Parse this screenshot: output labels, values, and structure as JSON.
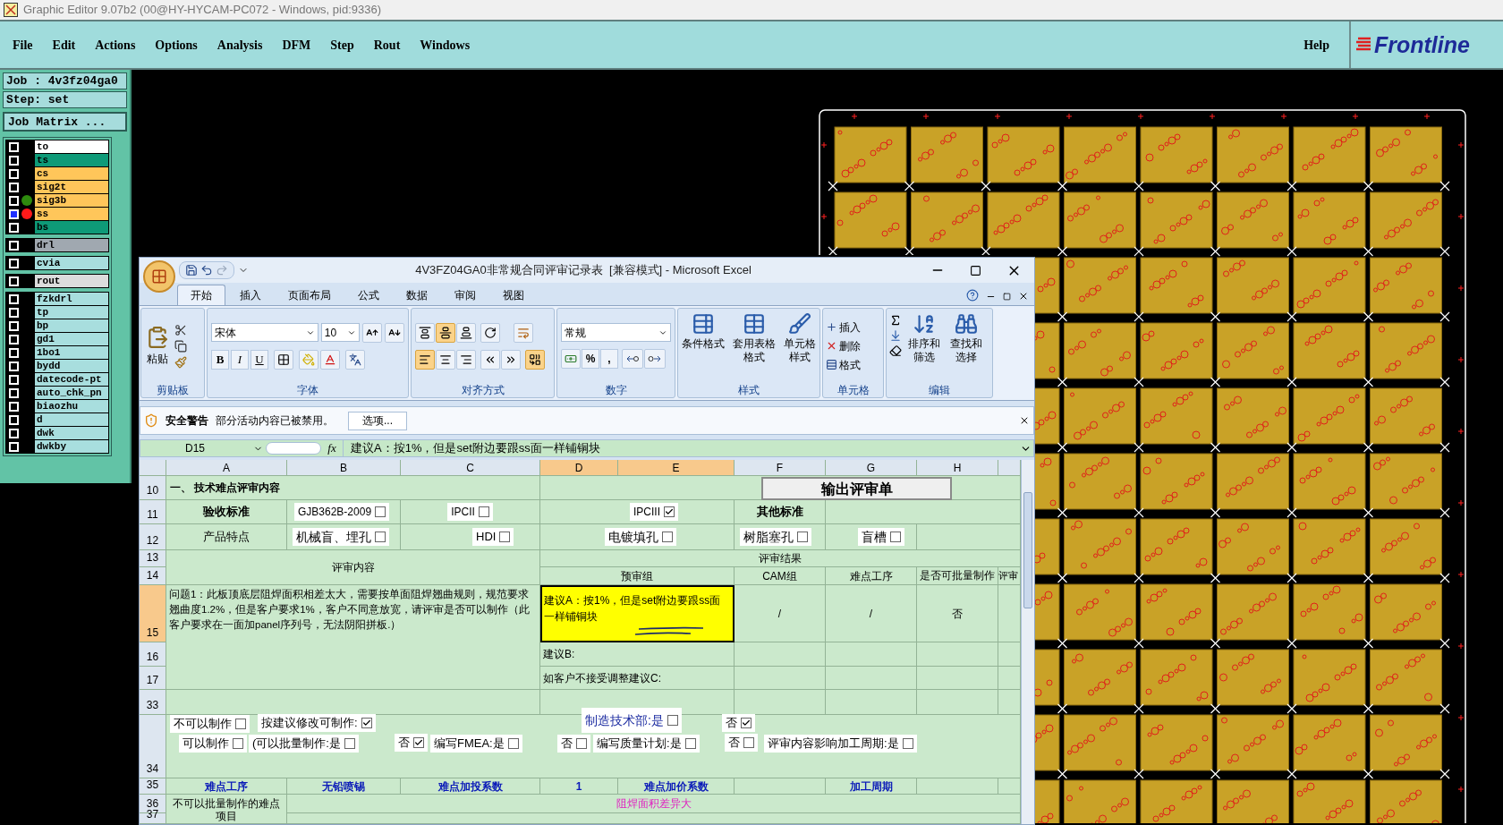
{
  "window": {
    "title": "Graphic Editor 9.07b2 (00@HY-HYCAM-PC072 - Windows, pid:9336)"
  },
  "menu": [
    "File",
    "Edit",
    "Actions",
    "Options",
    "Analysis",
    "DFM",
    "Step",
    "Rout",
    "Windows"
  ],
  "help": "Help",
  "logo": "Frontline",
  "job": "Job : 4v3fz04ga0",
  "step": "Step: set",
  "job_matrix": "Job Matrix ...",
  "layer_groups": [
    {
      "items": [
        {
          "name": "to",
          "color": "#ffffff",
          "selected": false
        },
        {
          "name": "ts",
          "color": "#0e9a78",
          "selected": false
        },
        {
          "name": "cs",
          "color": "#ffc65a",
          "selected": false
        },
        {
          "name": "sig2t",
          "color": "#ffc65a",
          "selected": false
        },
        {
          "name": "sig3b",
          "color": "#ffc65a",
          "selected": false,
          "dot": {
            "color": "#2e8b0e"
          }
        },
        {
          "name": "ss",
          "color": "#ffc65a",
          "selected": true,
          "dot": {
            "color": "#ff1a1a"
          }
        },
        {
          "name": "bs",
          "color": "#0e9a78",
          "selected": false
        }
      ]
    },
    {
      "items": [
        {
          "name": "drl",
          "color": "#a0a8b0",
          "selected": false
        }
      ]
    },
    {
      "items": [
        {
          "name": "cvia",
          "color": "#a8dede",
          "selected": false
        }
      ]
    },
    {
      "items": [
        {
          "name": "rout",
          "color": "#dcdcdc",
          "selected": false
        }
      ]
    },
    {
      "items": [
        {
          "name": "fzkdrl",
          "color": "#a8dede",
          "selected": false
        },
        {
          "name": "tp",
          "color": "#a8dede",
          "selected": false
        },
        {
          "name": "bp",
          "color": "#a8dede",
          "selected": false
        },
        {
          "name": "gd1",
          "color": "#a8dede",
          "selected": false
        },
        {
          "name": "1bo1",
          "color": "#a8dede",
          "selected": false
        },
        {
          "name": "bydd",
          "color": "#a8dede",
          "selected": false
        },
        {
          "name": "datecode-pt",
          "color": "#a8dede",
          "selected": false
        },
        {
          "name": "auto_chk_pn",
          "color": "#a8dede",
          "selected": false
        },
        {
          "name": "biaozhu",
          "color": "#a8dede",
          "selected": false
        },
        {
          "name": "d",
          "color": "#a8dede",
          "selected": false
        },
        {
          "name": "dwk",
          "color": "#a8dede",
          "selected": false
        },
        {
          "name": "dwkby",
          "color": "#a8dede",
          "selected": false
        }
      ]
    }
  ],
  "excel": {
    "title": "4V3FZ04GA0非常规合同评审记录表  [兼容模式] - Microsoft Excel",
    "tabs": [
      {
        "label": "开始",
        "selected": true
      },
      {
        "label": "插入",
        "selected": false
      },
      {
        "label": "页面布局",
        "selected": false
      },
      {
        "label": "公式",
        "selected": false
      },
      {
        "label": "数据",
        "selected": false
      },
      {
        "label": "审阅",
        "selected": false
      },
      {
        "label": "视图",
        "selected": false
      }
    ],
    "ribbon": {
      "groups": [
        "剪贴板",
        "字体",
        "对齐方式",
        "数字",
        "样式",
        "单元格",
        "编辑"
      ],
      "paste": "粘贴",
      "font": "宋体",
      "size": "10",
      "format_buttons": [
        "B",
        "I",
        "U"
      ],
      "vertical_align": [
        {
          "kind": "top",
          "selected": false
        },
        {
          "kind": "middle",
          "selected": true
        },
        {
          "kind": "bottom",
          "selected": false
        }
      ],
      "horizontal_align": [
        {
          "kind": "left",
          "selected": true
        },
        {
          "kind": "center",
          "selected": false
        },
        {
          "kind": "right",
          "selected": false
        }
      ],
      "merge": {
        "selected": true
      },
      "number_format": "常规",
      "number_buttons": [
        "%",
        ","
      ],
      "styles": [
        "条件格式",
        "套用表格格式",
        "单元格样式"
      ],
      "cells": [
        "插入",
        "删除",
        "格式"
      ],
      "editing": [
        "排序和筛选",
        "查找和选择"
      ]
    },
    "security": {
      "title": "安全警告",
      "message": "部分活动内容已被禁用。",
      "button": "选项..."
    },
    "formula": {
      "cell": "D15",
      "fx": "fx",
      "content": "建议A：按1%，但是set附边要跟ss面一样铺铜块"
    },
    "sheet": {
      "columns": [
        {
          "label": "A",
          "selected": false
        },
        {
          "label": "B",
          "selected": false
        },
        {
          "label": "C",
          "selected": false
        },
        {
          "label": "D",
          "selected": true
        },
        {
          "label": "E",
          "selected": true
        },
        {
          "label": "F",
          "selected": false
        },
        {
          "label": "G",
          "selected": false
        },
        {
          "label": "H",
          "selected": false
        }
      ],
      "rows": [
        {
          "label": "10",
          "selected": false
        },
        {
          "label": "11",
          "selected": false
        },
        {
          "label": "12",
          "selected": false
        },
        {
          "label": "13",
          "selected": false
        },
        {
          "label": "14",
          "selected": false
        },
        {
          "label": "15",
          "selected": true
        },
        {
          "label": "16",
          "selected": false
        },
        {
          "label": "17",
          "selected": false
        },
        {
          "label": "33",
          "selected": false
        },
        {
          "label": "34",
          "selected": false
        },
        {
          "label": "35",
          "selected": false
        },
        {
          "label": "36",
          "selected": false
        },
        {
          "label": "37",
          "selected": false
        }
      ],
      "section_title": "一、 技术难点评审内容",
      "export_button": "输出评审单",
      "standard": {
        "label": "验收标准",
        "options": [
          {
            "label": "GJB362B-2009",
            "checked": false
          },
          {
            "label": "IPCII",
            "checked": false
          },
          {
            "label": "IPCIII",
            "checked": true
          }
        ],
        "other": "其他标准"
      },
      "features": {
        "label": "产品特点",
        "options": [
          {
            "label": "机械盲、埋孔",
            "checked": false
          },
          {
            "label": "HDI",
            "checked": false
          },
          {
            "label": "电镀填孔",
            "checked": false
          },
          {
            "label": "树脂塞孔",
            "checked": false
          },
          {
            "label": "盲槽",
            "checked": false
          }
        ]
      },
      "review_content": "评审内容",
      "review_result": "评审结果",
      "result_columns": [
        "预审组",
        "CAM组",
        "难点工序",
        "是否可批量制作",
        "评审"
      ],
      "problem": "问题1：此板顶底层阻焊面积相差太大，需要按单面阻焊翘曲规则，规范要求翘曲度1.2%，但是客户要求1%，客户不同意放宽，请评审是否可以制作（此客户要求在一面加panel序列号，无法阴阳拼板.）",
      "suggestion_a": "建议A：按1%，但是set附边要跟ss面一样铺铜块",
      "results_a": [
        "/",
        "/",
        "否"
      ],
      "suggestion_b": "建议B:",
      "suggestion_c": "如客户不接受调整建议C:",
      "decisions": [
        {
          "label": "不可以制作",
          "checked": false,
          "kind": "plain"
        },
        {
          "label": "按建议修改可制作:",
          "checked": true,
          "kind": "plain"
        },
        {
          "label": "制造技术部:是",
          "checked": false,
          "kind": "department"
        },
        {
          "label": "否",
          "checked": true,
          "kind": "plain"
        },
        {
          "label": "可以制作",
          "checked": false,
          "kind": "plain"
        },
        {
          "label": "(可以批量制作:是",
          "checked": false,
          "kind": "plain"
        },
        {
          "label": "否",
          "checked": true,
          "kind": "plain"
        },
        {
          "label": "编写FMEA:是",
          "checked": false,
          "kind": "plain"
        },
        {
          "label": "否",
          "checked": false,
          "kind": "plain"
        },
        {
          "label": "编写质量计划:是",
          "checked": false,
          "kind": "plain"
        },
        {
          "label": "否",
          "checked": false,
          "kind": "plain"
        },
        {
          "label": "评审内容影响加工周期:是",
          "checked": false,
          "kind": "plain"
        }
      ],
      "row35": {
        "a": "难点工序",
        "b": "无铅喷锡",
        "c": "难点加投系数",
        "d": "1",
        "e": "难点加价系数",
        "g": "加工周期"
      },
      "row36": {
        "label": "不可以批量制作的难点项目",
        "value": "阻焊面积差异大"
      }
    }
  }
}
